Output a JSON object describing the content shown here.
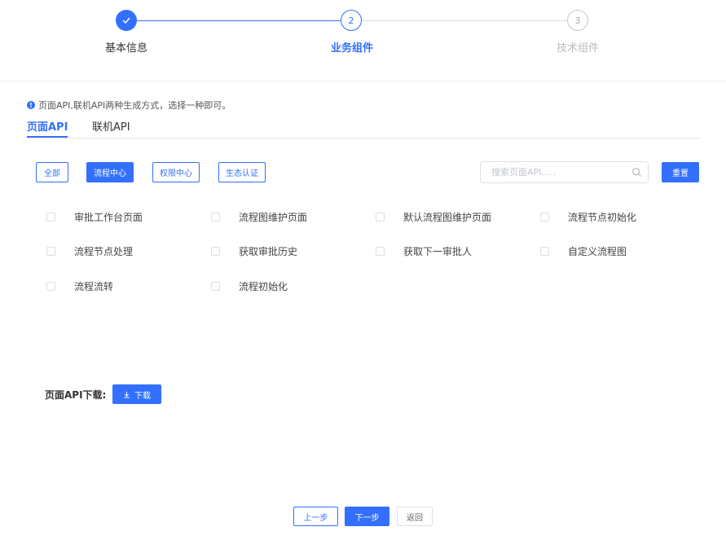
{
  "steps": [
    {
      "label": "基本信息",
      "number": "1",
      "status": "done"
    },
    {
      "label": "业务组件",
      "number": "2",
      "status": "active"
    },
    {
      "label": "技术组件",
      "number": "3",
      "status": "todo"
    }
  ],
  "notice": "页面API,联机API两种生成方式，选择一种即可。",
  "tabs": [
    "页面API",
    "联机API"
  ],
  "filters": [
    "全部",
    "流程中心",
    "权限中心",
    "生态认证"
  ],
  "search": {
    "placeholder": "搜索页面API....."
  },
  "reset_label": "重置",
  "api_items": [
    "审批工作台页面",
    "流程图维护页面",
    "默认流程图维护页面",
    "流程节点初始化",
    "流程节点处理",
    "获取审批历史",
    "获取下一审批人",
    "自定义流程图",
    "流程流转",
    "流程初始化"
  ],
  "download": {
    "label": "页面API下载:",
    "button": "下载"
  },
  "footer": {
    "prev": "上一步",
    "next": "下一步",
    "back": "返回"
  },
  "colors": {
    "primary": "#3370ff",
    "border": "#dcdfe6"
  }
}
